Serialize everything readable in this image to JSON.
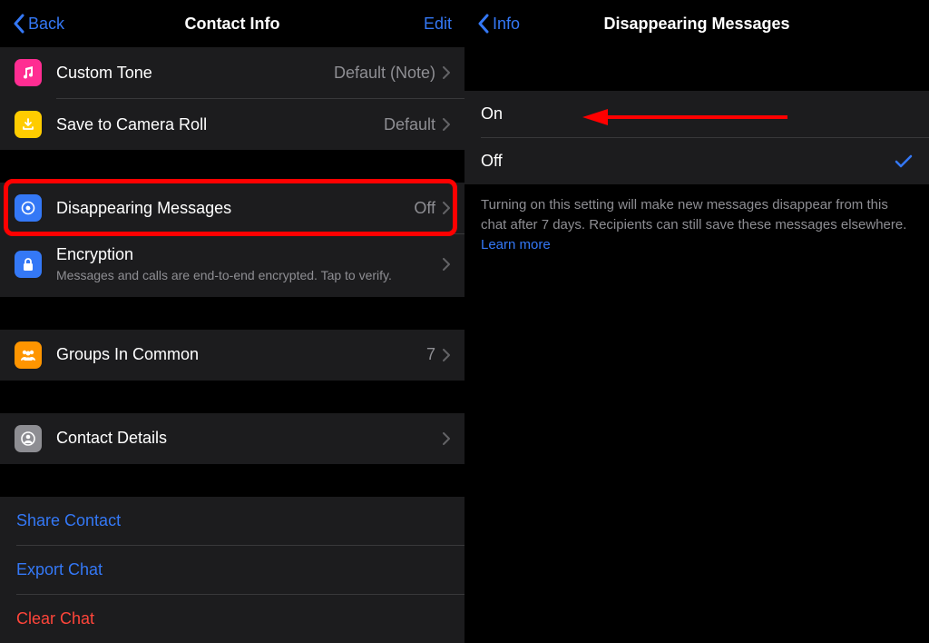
{
  "left": {
    "nav": {
      "back": "Back",
      "title": "Contact Info",
      "edit": "Edit"
    },
    "rows": {
      "custom_tone": {
        "label": "Custom Tone",
        "value": "Default (Note)"
      },
      "camera_roll": {
        "label": "Save to Camera Roll",
        "value": "Default"
      },
      "disappearing": {
        "label": "Disappearing Messages",
        "value": "Off"
      },
      "encryption": {
        "label": "Encryption",
        "sub": "Messages and calls are end-to-end encrypted. Tap to verify."
      },
      "groups": {
        "label": "Groups In Common",
        "value": "7"
      },
      "contact_details": {
        "label": "Contact Details"
      }
    },
    "actions": {
      "share": "Share Contact",
      "export": "Export Chat",
      "clear": "Clear Chat"
    }
  },
  "right": {
    "nav": {
      "back": "Info",
      "title": "Disappearing Messages"
    },
    "options": {
      "on": "On",
      "off": "Off"
    },
    "help": "Turning on this setting will make new messages disappear from this chat after 7 days. Recipients can still save these messages elsewhere. ",
    "learn_more": "Learn more"
  },
  "colors": {
    "pink": "#ff2d92",
    "yellow": "#ffcc00",
    "blue": "#3478f6",
    "orange": "#ff9500",
    "gray": "#8e8e93"
  }
}
